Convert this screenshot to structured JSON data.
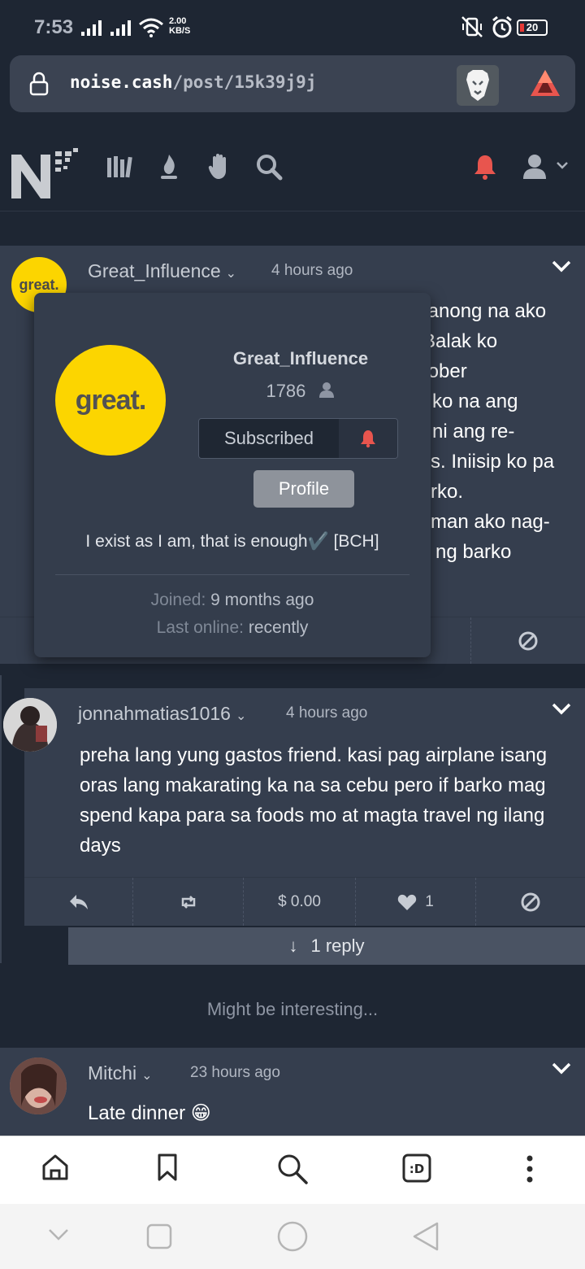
{
  "status": {
    "time": "7:53",
    "speed_value": "2.00",
    "speed_unit": "KB/S",
    "battery": "20"
  },
  "browser": {
    "url_domain": "noise.cash",
    "url_path": "/post/15k39j9j"
  },
  "header": {
    "nav_icons": [
      "library-icon",
      "flame-icon",
      "hand-icon",
      "search-icon"
    ],
    "notification_color": "#e8554e"
  },
  "post1": {
    "username": "Great_Influence",
    "time": "4 hours ago",
    "avatar_text": "great.",
    "visible_lines": [
      "tanong na ako",
      "Balak ko",
      "tober",
      "ko na ang",
      "ni ang re-",
      "s. Iniisip ko pa",
      "rko.",
      "man ako nag-",
      "ng barko"
    ]
  },
  "popup": {
    "avatar_text": "great.",
    "name": "Great_Influence",
    "followers": "1786",
    "subscribed_label": "Subscribed",
    "profile_label": "Profile",
    "bio": "I exist as I am, that is enough✔️ [BCH]",
    "joined_label": "Joined:",
    "joined_value": "9 months ago",
    "online_label": "Last online:",
    "online_value": "recently"
  },
  "post2": {
    "username": "jonnahmatias1016",
    "time": "4 hours ago",
    "body": "preha lang yung gastos friend. kasi pag airplane isang oras lang makarating ka na sa cebu pero if barko mag spend kapa para sa foods mo at magta travel ng ilang days",
    "tip": "$ 0.00",
    "likes": "1",
    "reply_label": "1 reply"
  },
  "interesting_label": "Might be interesting...",
  "post3": {
    "username": "Mitchi",
    "time": "23 hours ago",
    "body": "Late dinner 😁"
  }
}
